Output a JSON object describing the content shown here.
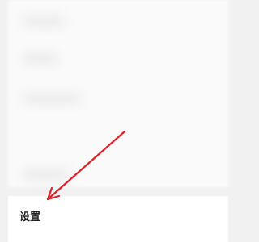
{
  "settings": {
    "label": "设置"
  },
  "annotation": {
    "color": "#e0202a"
  }
}
